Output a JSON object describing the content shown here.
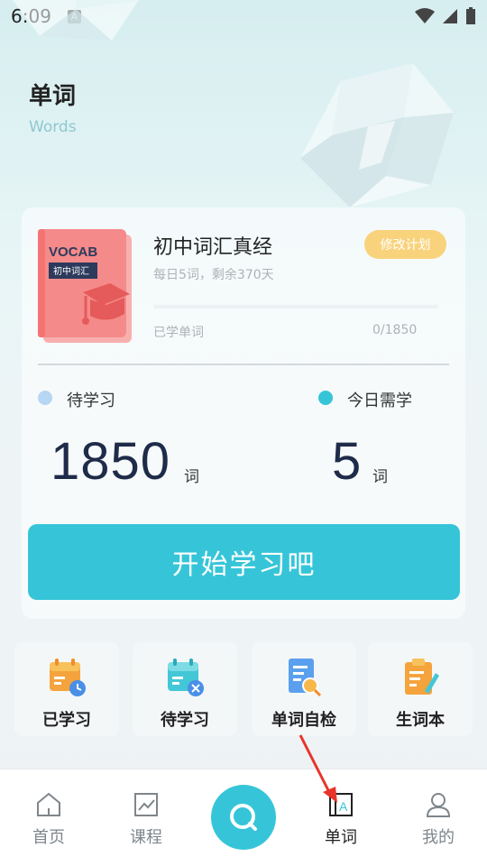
{
  "status_bar": {
    "time": "6:09",
    "badge": "A"
  },
  "header": {
    "title": "单词",
    "subtitle": "Words"
  },
  "plan": {
    "book_cover_title": "VOCAB",
    "book_cover_tag": "初中词汇",
    "book_name": "初中词汇真经",
    "description": "每日5词，剩余370天",
    "modify_label": "修改计划",
    "learned_label": "已学单词",
    "learned_count": "0/1850",
    "progress_fraction": 0
  },
  "stats": {
    "pending_label": "待学习",
    "pending_value": "1850",
    "pending_unit": "词",
    "today_label": "今日需学",
    "today_value": "5",
    "today_unit": "词"
  },
  "start_button": "开始学习吧",
  "quick_actions": [
    {
      "label": "已学习",
      "icon": "calendar-clock-icon"
    },
    {
      "label": "待学习",
      "icon": "calendar-tools-icon"
    },
    {
      "label": "单词自检",
      "icon": "document-search-icon"
    },
    {
      "label": "生词本",
      "icon": "clipboard-pen-icon"
    }
  ],
  "tabbar": [
    {
      "label": "首页",
      "icon": "home-icon"
    },
    {
      "label": "课程",
      "icon": "chart-icon"
    },
    {
      "label": "",
      "icon": "search-icon"
    },
    {
      "label": "单词",
      "icon": "word-book-icon",
      "active": true
    },
    {
      "label": "我的",
      "icon": "profile-icon"
    }
  ],
  "colors": {
    "accent": "#36c5d8",
    "plan_button": "#f9d37c",
    "book_cover": "#f58a8a",
    "pending_dot": "#b7d6f3",
    "today_dot": "#36c5d8",
    "number": "#1e2b49",
    "annotation_arrow": "#e8342a"
  }
}
